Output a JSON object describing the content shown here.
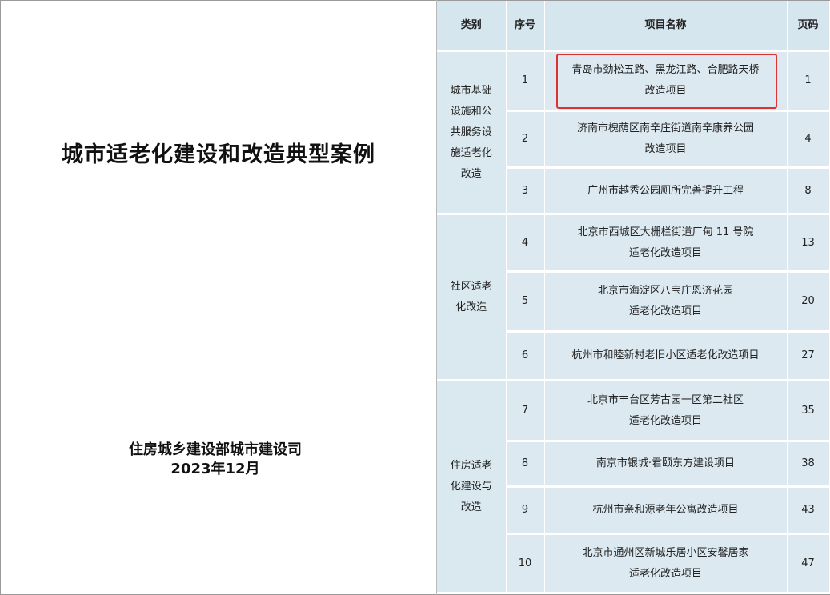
{
  "left_page": {
    "title": "城市适老化建设和改造典型案例",
    "publisher": "住房城乡建设部城市建设司",
    "date": "2023年12月"
  },
  "toc": {
    "headers": {
      "category": "类别",
      "seq": "序号",
      "name": "项目名称",
      "page": "页码"
    },
    "categories": [
      {
        "label": "城市基础设施和公共服务设施适老化改造"
      },
      {
        "label": "社区适老化改造"
      },
      {
        "label": "住房适老化建设与改造"
      }
    ],
    "rows": [
      {
        "seq": "1",
        "name_line1": "青岛市劲松五路、黑龙江路、合肥路天桥",
        "name_line2": "改造项目",
        "page": "1",
        "highlighted": true
      },
      {
        "seq": "2",
        "name_line1": "济南市槐荫区南辛庄街道南辛康养公园",
        "name_line2": "改造项目",
        "page": "4"
      },
      {
        "seq": "3",
        "name_line1": "广州市越秀公园厕所完善提升工程",
        "name_line2": "",
        "page": "8"
      },
      {
        "seq": "4",
        "name_line1": "北京市西城区大栅栏街道厂甸 11 号院",
        "name_line2": "适老化改造项目",
        "page": "13"
      },
      {
        "seq": "5",
        "name_line1": "北京市海淀区八宝庄恩济花园",
        "name_line2": "适老化改造项目",
        "page": "20"
      },
      {
        "seq": "6",
        "name_line1": "杭州市和睦新村老旧小区适老化改造项目",
        "name_line2": "",
        "page": "27"
      },
      {
        "seq": "7",
        "name_line1": "北京市丰台区芳古园一区第二社区",
        "name_line2": "适老化改造项目",
        "page": "35"
      },
      {
        "seq": "8",
        "name_line1": "南京市银城·君颐东方建设项目",
        "name_line2": "",
        "page": "38"
      },
      {
        "seq": "9",
        "name_line1": "杭州市亲和源老年公寓改造项目",
        "name_line2": "",
        "page": "43"
      },
      {
        "seq": "10",
        "name_line1": "北京市通州区新城乐居小区安馨居家",
        "name_line2": "适老化改造项目",
        "page": "47"
      }
    ]
  }
}
